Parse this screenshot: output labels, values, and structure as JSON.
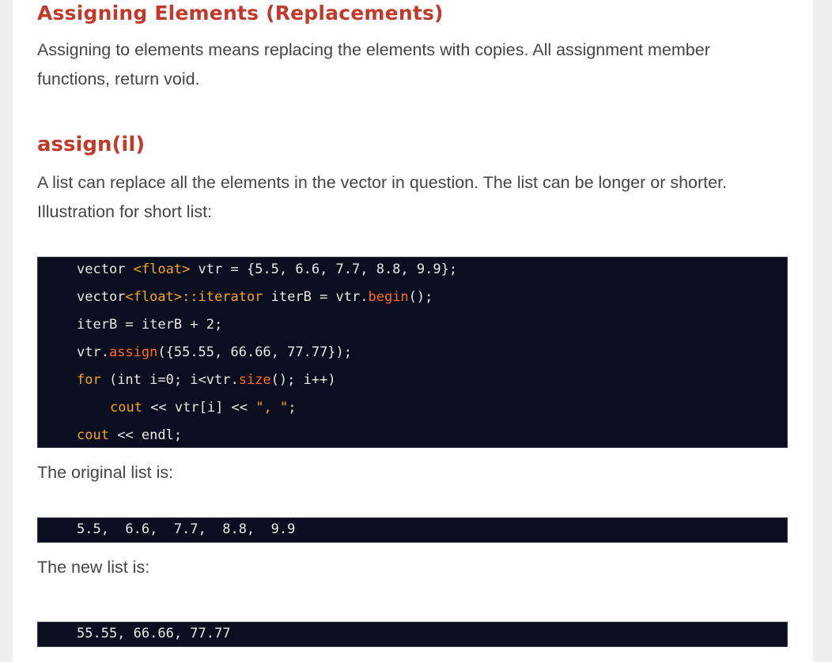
{
  "section": {
    "heading": "Assigning Elements (Replacements)",
    "intro_line1": "Assigning to elements means replacing the elements with copies. All assignment member",
    "intro_line2": "functions, return void."
  },
  "subsection": {
    "heading": "assign(il)",
    "desc_line1": "A list can replace all the elements in the vector in question. The list can be longer or shorter.",
    "desc_line2": "Illustration for short list:"
  },
  "code_block": {
    "line1": {
      "a": "vector ",
      "b": "<float>",
      "c": " vtr = {5.5, 6.6, 7.7, 8.8, 9.9};"
    },
    "line2": {
      "a": "vector",
      "b": "<float>::iterator",
      "c": " iterB = vtr.",
      "d": "begin",
      "e": "();"
    },
    "line3": {
      "a": "iterB = iterB + 2;"
    },
    "line4": {
      "a": "vtr.",
      "b": "assign",
      "c": "({55.55, 66.66, 77.77});"
    },
    "line5": {
      "a": "for",
      "b": " (int i=0; i<vtr.",
      "c": "size",
      "d": "(); i++)"
    },
    "line6": {
      "a": "cout",
      "b": " << vtr[i] << ",
      "c": "\", \"",
      "d": ";"
    },
    "line7": {
      "a": "cout",
      "b": " << endl;"
    }
  },
  "original_label": "The original list is:",
  "original_output": "5.5,  6.6,  7.7,  8.8,  9.9",
  "new_label": "The new list is:",
  "new_output": "55.55, 66.66, 77.77"
}
